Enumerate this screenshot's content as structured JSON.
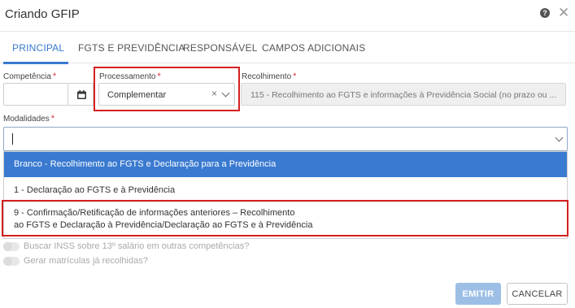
{
  "dialog": {
    "title": "Criando GFIP"
  },
  "tabs": [
    {
      "label": "PRINCIPAL",
      "active": true
    },
    {
      "label": "FGTS E PREVIDÊNCIA"
    },
    {
      "label": "RESPONSÁVEL"
    },
    {
      "label": "CAMPOS ADICIONAIS"
    }
  ],
  "form": {
    "competencia": {
      "label": "Competência",
      "value": ""
    },
    "processamento": {
      "label": "Processamento",
      "value": "Complementar"
    },
    "recolhimento": {
      "label": "Recolhimento",
      "value": "115 - Recolhimento ao FGTS e informações à Previdência Social (no prazo ou ..."
    },
    "modalidades": {
      "label": "Modalidades",
      "value": "",
      "options": [
        {
          "label": "Branco - Recolhimento ao FGTS e Declaração para a Previdência",
          "selected": true
        },
        {
          "label": "1 - Declaração ao FGTS e à Previdência"
        },
        {
          "line1": "9 - Confirmação/Retificação de informações anteriores – Recolhimento",
          "line2": "ao FGTS e Declaração à Previdência/Declaração ao FGTS e à Previdência"
        }
      ]
    },
    "required_mark": "*"
  },
  "toggles": [
    {
      "label": "Buscar INSS sobre 13º salário em outras competências?",
      "on": false
    },
    {
      "label": "Gerar matrículas já recolhidas?",
      "on": false
    }
  ],
  "buttons": {
    "emitir": "EMITIR",
    "cancelar": "CANCELAR"
  },
  "colors": {
    "accent": "#3a7ad0",
    "highlight": "#d42020",
    "required": "#dd3333"
  }
}
